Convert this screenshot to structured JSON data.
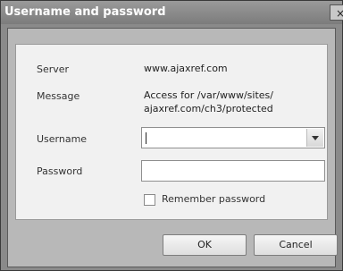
{
  "window": {
    "title": "Username and password",
    "close_glyph": "×"
  },
  "fields": {
    "server_label": "Server",
    "server_value": "www.ajaxref.com",
    "message_label": "Message",
    "message_line1": "Access for /var/www/sites/",
    "message_line2": "ajaxref.com/ch3/protected",
    "username_label": "Username",
    "username_value": "",
    "password_label": "Password",
    "password_value": ""
  },
  "options": {
    "remember_label": "Remember password",
    "remember_checked": false
  },
  "buttons": {
    "ok_label": "OK",
    "cancel_label": "Cancel"
  },
  "icons": {
    "close": "close-icon",
    "dropdown": "chevron-down-icon"
  }
}
